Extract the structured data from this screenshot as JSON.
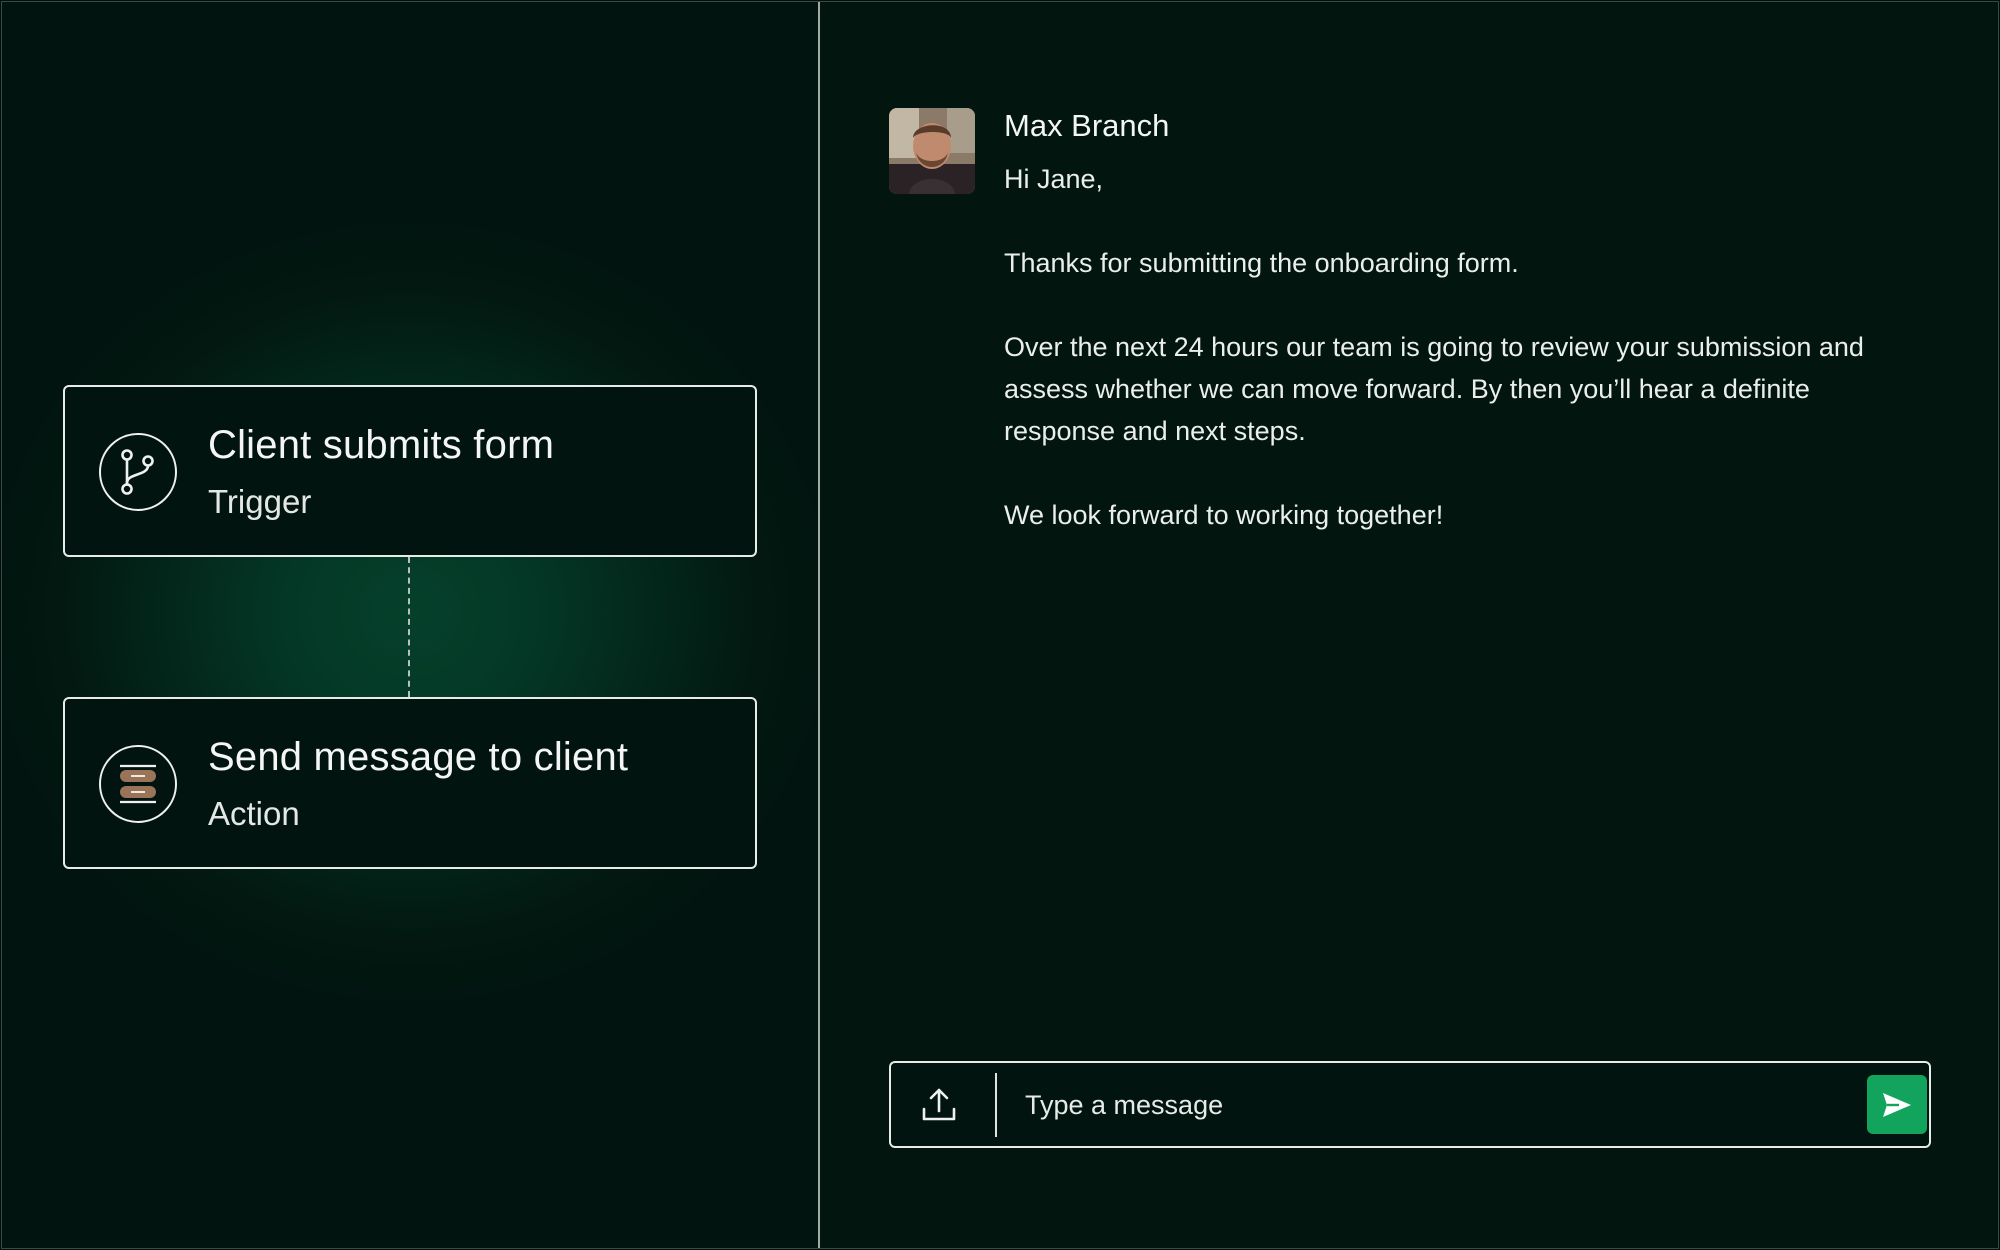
{
  "workflow": {
    "steps": [
      {
        "title": "Client submits form",
        "type": "Trigger",
        "icon": "git-branch-icon"
      },
      {
        "title": "Send message to client",
        "type": "Action",
        "icon": "stacked-messages-icon"
      }
    ]
  },
  "chat": {
    "sender": "Max Branch",
    "message_lines": [
      "Hi Jane,",
      "Thanks for submitting the onboarding form.",
      "Over the next 24 hours our team is going to review your submission and assess whether we can move forward. By then you’ll hear a definite response and next steps.",
      "We look forward to working together!"
    ]
  },
  "composer": {
    "placeholder": "Type a message",
    "upload_icon": "upload-icon",
    "send_icon": "send-icon"
  },
  "colors": {
    "background": "#02140f",
    "glow": "#05402b",
    "send_button": "#12a35c",
    "border": "#e8ece9"
  }
}
